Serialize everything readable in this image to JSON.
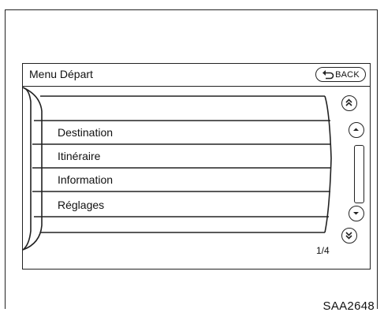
{
  "screen": {
    "title": "Menu Départ",
    "back_label": "BACK",
    "menu_items": [
      {
        "label": "Destination"
      },
      {
        "label": "Itinéraire"
      },
      {
        "label": "Information"
      },
      {
        "label": "Réglages"
      }
    ],
    "page_indicator": "1/4"
  },
  "icons": {
    "back": "back-arrow-icon",
    "page_up": "double-chevron-up-icon",
    "scroll_up": "chevron-up-icon",
    "scroll_down": "chevron-down-icon",
    "page_down": "double-chevron-down-icon"
  },
  "figure_code": "SAA2648"
}
